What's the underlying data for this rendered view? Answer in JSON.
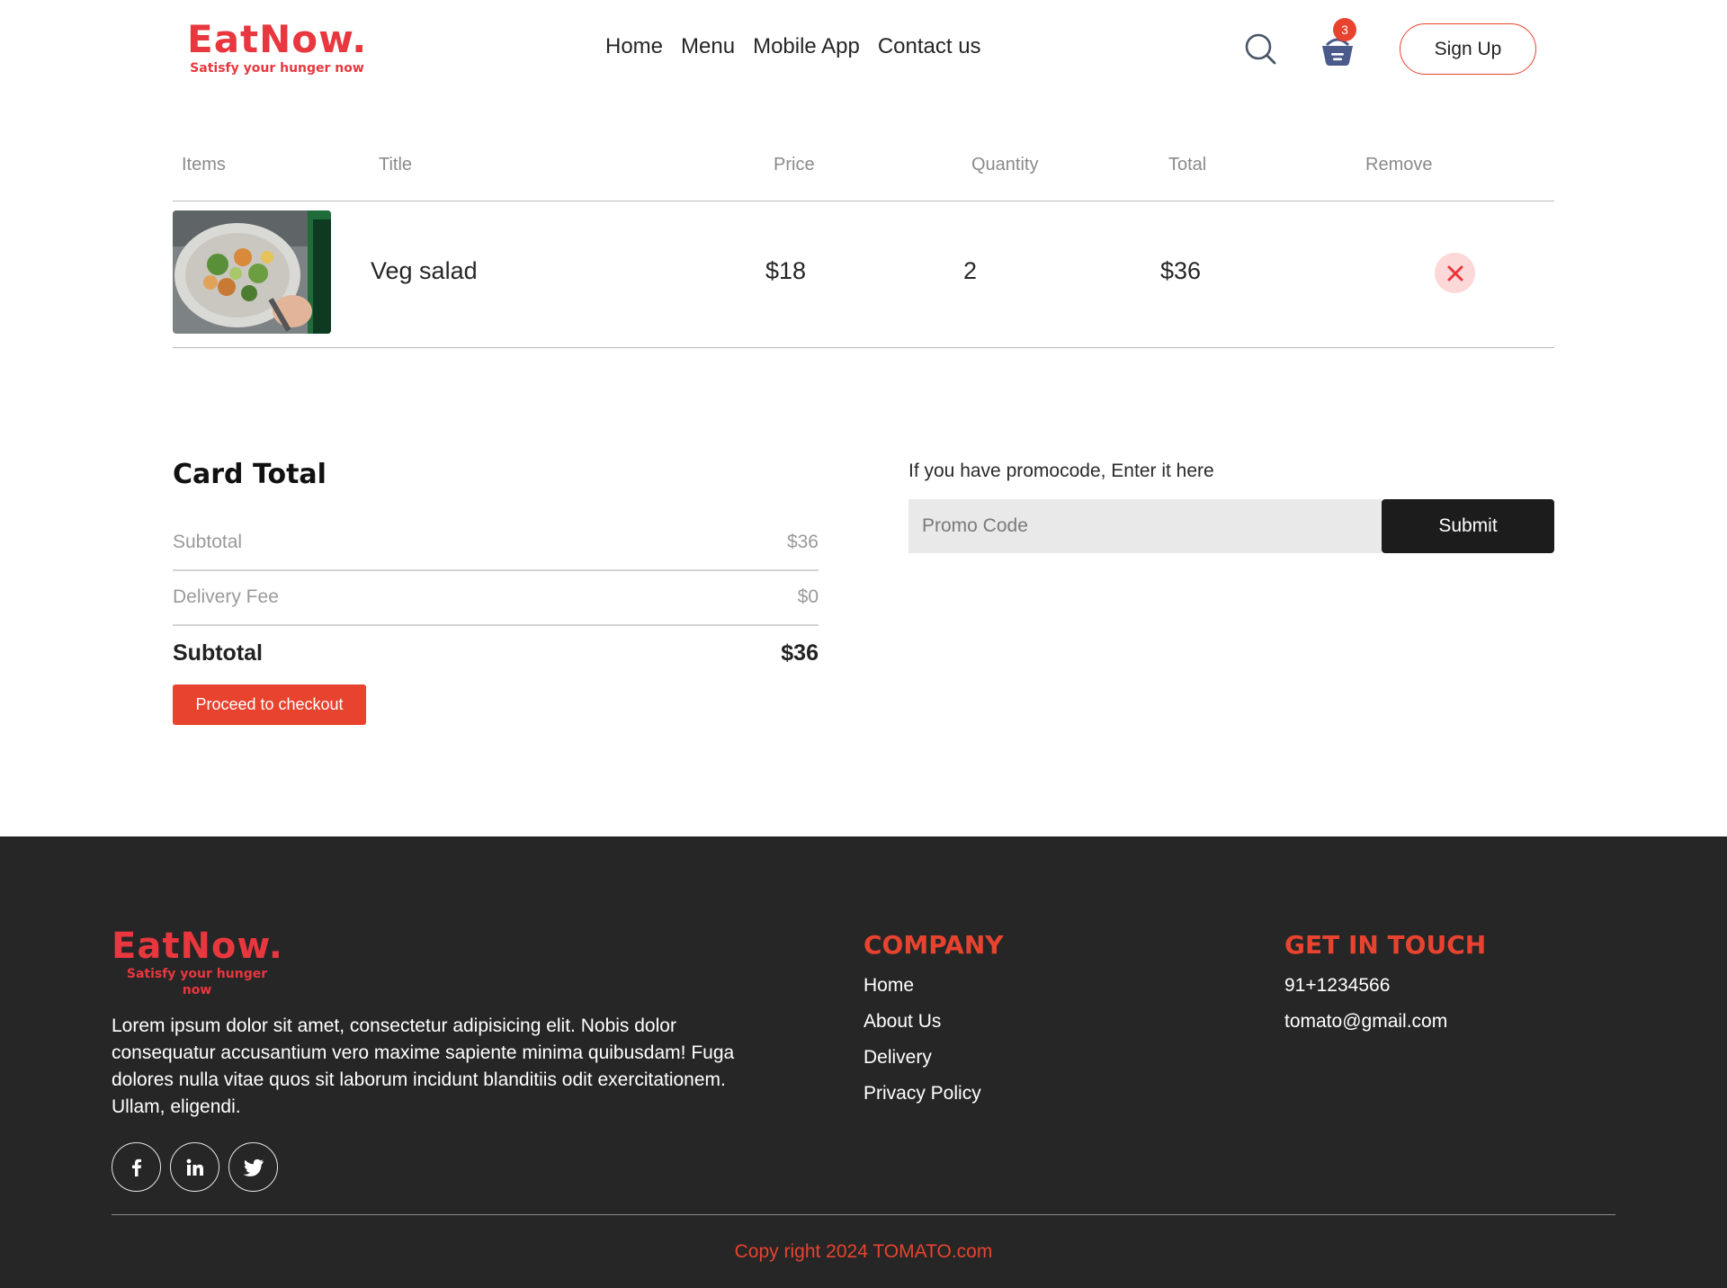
{
  "brand": {
    "name": "EatNow.",
    "tagline": "Satisfy your hunger now",
    "accent_color": "#e8432f",
    "logo_color": "#e8373e"
  },
  "header": {
    "nav": [
      "Home",
      "Menu",
      "Mobile App",
      "Contact us"
    ],
    "search_icon": "search-icon",
    "basket_icon": "basket-icon",
    "cart_count": "3",
    "signup_label": "Sign Up"
  },
  "cart": {
    "columns": [
      "Items",
      "Title",
      "Price",
      "Quantity",
      "Total",
      "Remove"
    ],
    "items": [
      {
        "image": "veg-salad-photo",
        "title": "Veg salad",
        "price": "$18",
        "quantity": "2",
        "total": "$36",
        "remove_icon": "close-icon"
      }
    ]
  },
  "totals": {
    "title": "Card Total",
    "subtotal_label": "Subtotal",
    "subtotal_value": "$36",
    "delivery_label": "Delivery Fee",
    "delivery_value": "$0",
    "final_label": "Subtotal",
    "final_value": "$36",
    "checkout_label": "Proceed to checkout"
  },
  "promo": {
    "label": "If you have promocode, Enter it here",
    "placeholder": "Promo Code",
    "submit_label": "Submit"
  },
  "footer": {
    "description": "Lorem ipsum dolor sit amet, consectetur adipisicing elit. Nobis dolor consequatur accusantium vero maxime sapiente minima quibusdam! Fuga dolores nulla vitae quos sit laborum incidunt blanditiis odit exercitationem. Ullam, eligendi.",
    "social_icons": [
      "facebook-icon",
      "linkedin-icon",
      "twitter-icon"
    ],
    "company_heading": "COMPANY",
    "company_links": [
      "Home",
      "About Us",
      "Delivery",
      "Privacy Policy"
    ],
    "contact_heading": "GET IN TOUCH",
    "phone": "91+1234566",
    "email": "tomato@gmail.com",
    "copyright": "Copy right 2024 TOMATO.com"
  }
}
